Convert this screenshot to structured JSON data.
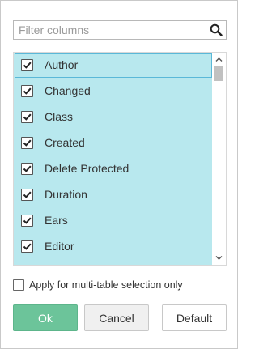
{
  "search": {
    "placeholder": "Filter columns",
    "value": "",
    "icon": "search-icon"
  },
  "columns": [
    {
      "label": "Author",
      "checked": true
    },
    {
      "label": "Changed",
      "checked": true
    },
    {
      "label": "Class",
      "checked": true
    },
    {
      "label": "Created",
      "checked": true
    },
    {
      "label": "Delete Protected",
      "checked": true
    },
    {
      "label": "Duration",
      "checked": true
    },
    {
      "label": "Ears",
      "checked": true
    },
    {
      "label": "Editor",
      "checked": true
    }
  ],
  "apply_option": {
    "label": "Apply for multi-table selection only",
    "checked": false
  },
  "buttons": {
    "ok": "Ok",
    "cancel": "Cancel",
    "default": "Default"
  },
  "colors": {
    "list_bg": "#b8e8ee",
    "ok_bg": "#6cc49a",
    "focus_outline": "#5ab8d8"
  }
}
